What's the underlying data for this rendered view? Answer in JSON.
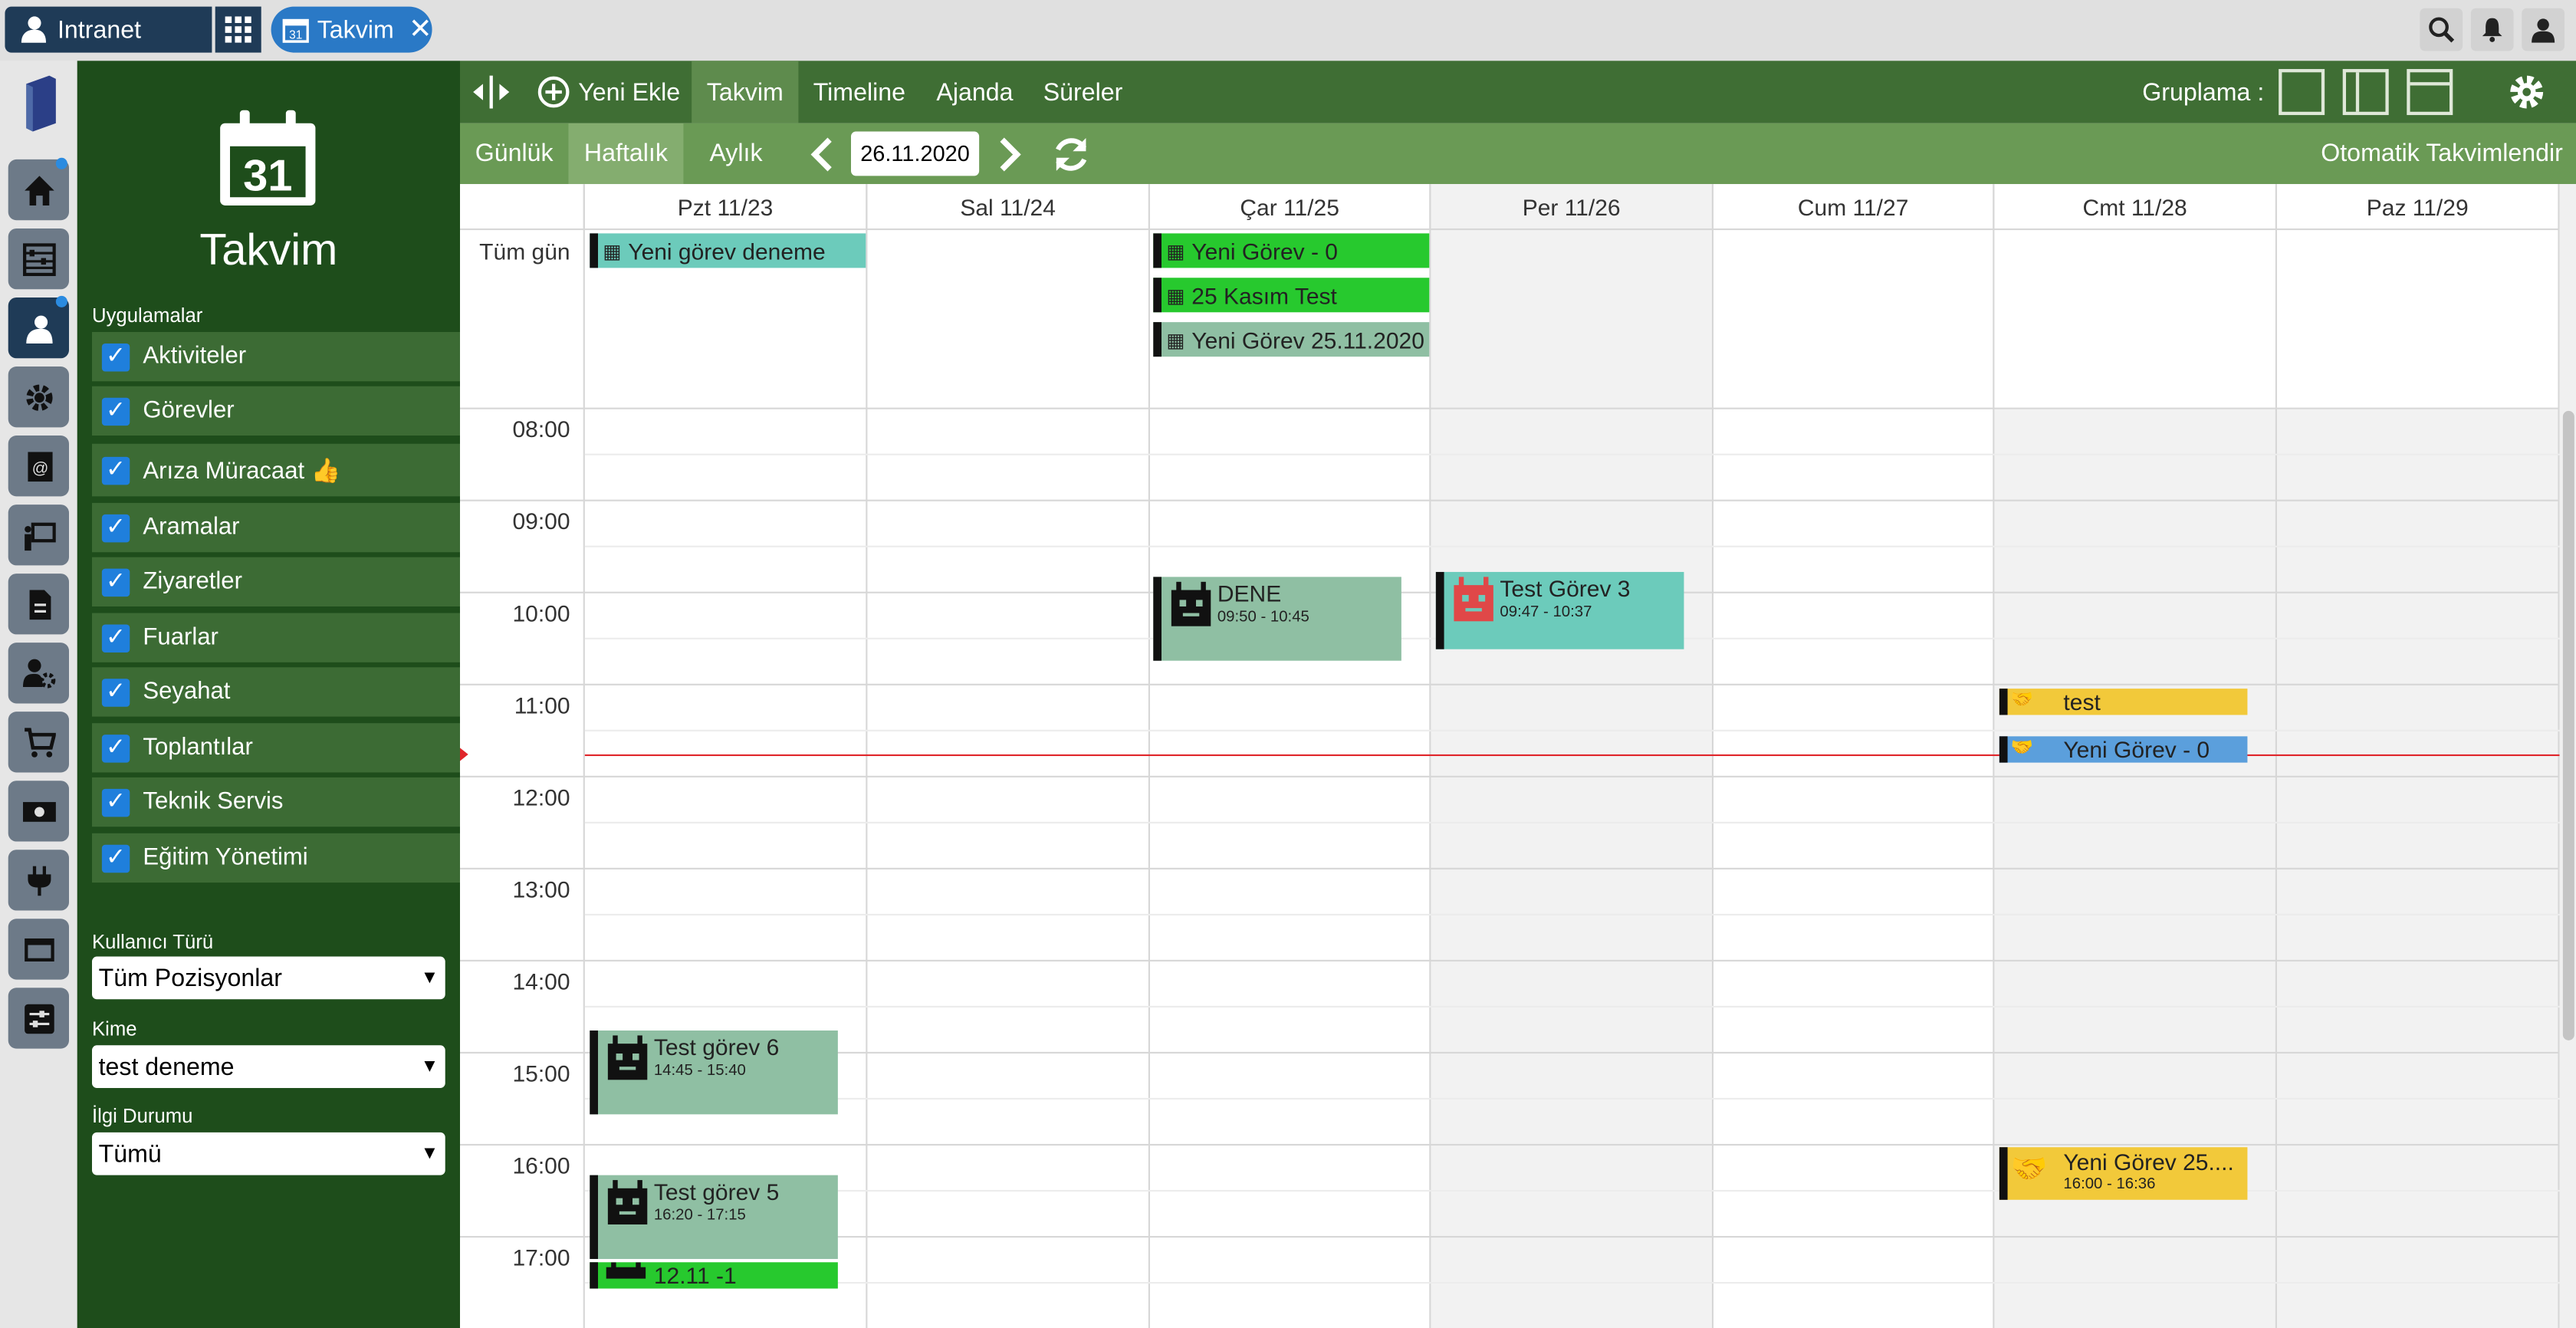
{
  "topbar": {
    "intranet_label": "Intranet",
    "tab_label": "Takvim",
    "tab_icon_text": "31"
  },
  "side": {
    "calendar_icon_text": "31",
    "title": "Takvim",
    "apps_label": "Uygulamalar",
    "apps": [
      "Aktiviteler",
      "Görevler",
      "Arıza Müracaat 👍",
      "Aramalar",
      "Ziyaretler",
      "Fuarlar",
      "Seyahat",
      "Toplantılar",
      "Teknik Servis",
      "Eğitim Yönetimi"
    ],
    "user_type_label": "Kullanıcı Türü",
    "user_type_value": "Tüm Pozisyonlar",
    "to_label": "Kime",
    "to_value": "test deneme",
    "interest_label": "İlgi Durumu",
    "interest_value": "Tümü"
  },
  "toolbar": {
    "new_label": "Yeni Ekle",
    "tabs": [
      "Takvim",
      "Timeline",
      "Ajanda",
      "Süreler"
    ],
    "grouping_label": "Gruplama :"
  },
  "subtoolbar": {
    "views": [
      "Günlük",
      "Haftalık",
      "Aylık"
    ],
    "date": "26.11.2020",
    "auto_sync": "Otomatik Takvimlendir"
  },
  "calendar": {
    "days": [
      "Pzt 11/23",
      "Sal 11/24",
      "Çar 11/25",
      "Per 11/26",
      "Cum 11/27",
      "Cmt 11/28",
      "Paz 11/29"
    ],
    "allday_label": "Tüm gün",
    "times": [
      "08:00",
      "09:00",
      "10:00",
      "11:00",
      "12:00",
      "13:00",
      "14:00",
      "15:00",
      "16:00",
      "17:00"
    ],
    "allday_events": [
      {
        "title": "Yeni görev deneme",
        "color": "#6ccbbb"
      },
      {
        "title": "Yeni Görev - 0",
        "color": "#27c92e"
      },
      {
        "title": "25 Kasım Test",
        "color": "#27c92e"
      },
      {
        "title": "Yeni Görev 25.11.2020",
        "color": "#8fbfa3"
      }
    ],
    "events": [
      {
        "title": "DENE",
        "time": "09:50 - 10:45",
        "color": "#8fbfa3"
      },
      {
        "title": "Test Görev 3",
        "time": "09:47 - 10:37",
        "color": "#6ccbbb"
      },
      {
        "title": "test",
        "time": "",
        "color": "#f2c93a"
      },
      {
        "title": "Yeni Görev - 0",
        "time": "",
        "color": "#5b9fdc"
      },
      {
        "title": "Test görev 6",
        "time": "14:45 - 15:40",
        "color": "#8fbfa3"
      },
      {
        "title": "Test görev 5",
        "time": "16:20 - 17:15",
        "color": "#8fbfa3"
      },
      {
        "title": "12.11 -1",
        "time": "",
        "color": "#27c92e"
      },
      {
        "title": "Yeni Görev 25....",
        "time": "16:00 - 16:36",
        "color": "#f2c93a"
      }
    ]
  }
}
